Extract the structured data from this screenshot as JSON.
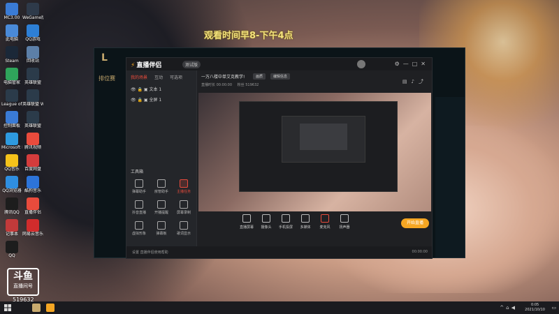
{
  "overlay": {
    "line1": "观看时间早8-下午4点"
  },
  "desktop_icons": [
    {
      "label": "MC3.00",
      "color": "#3a7bd5"
    },
    {
      "label": "WeGame版",
      "color": "#2e3a4a"
    },
    {
      "label": "此电脑",
      "color": "#4a8ad8"
    },
    {
      "label": "QQ游戏",
      "color": "#2d7fd6"
    },
    {
      "label": "Steam",
      "color": "#1b2838"
    },
    {
      "label": "回收站",
      "color": "#5c7fa8"
    },
    {
      "label": "电脑管家",
      "color": "#2fa45b"
    },
    {
      "label": "英雄联盟",
      "color": "#2b3b4a"
    },
    {
      "label": "League of Legends",
      "color": "#2b3b4a"
    },
    {
      "label": "英雄联盟 WeGame版",
      "color": "#2b3b4a"
    },
    {
      "label": "控制面板",
      "color": "#3a7bd5"
    },
    {
      "label": "英雄联盟",
      "color": "#2b3b4a"
    },
    {
      "label": "Microsoft Edge",
      "color": "#2e9adf"
    },
    {
      "label": "腾讯视频",
      "color": "#e94b3c"
    },
    {
      "label": "QQ音乐",
      "color": "#f5c21a"
    },
    {
      "label": "百度网盘",
      "color": "#d43c3c"
    },
    {
      "label": "QQ浏览器",
      "color": "#2f8ee0"
    },
    {
      "label": "酷狗音乐",
      "color": "#2d74d9"
    },
    {
      "label": "腾讯QQ",
      "color": "#1d1d1d"
    },
    {
      "label": "直播伴侣",
      "color": "#e94b3c"
    },
    {
      "label": "记事本",
      "color": "#c23a3a"
    },
    {
      "label": "网易云音乐",
      "color": "#d12c2c"
    },
    {
      "label": "QQ",
      "color": "#1d1d1d"
    }
  ],
  "lol": {
    "title": "排位赛"
  },
  "app": {
    "brand": "直播伴侣",
    "version": "测试版",
    "sidebar": {
      "tabs": [
        "我的场景",
        "互动",
        "可选项"
      ],
      "scenes": [
        "文本 1",
        "全屏 1"
      ],
      "tools_title": "工具箱",
      "tools": [
        {
          "label": "弹幕助手",
          "red": false
        },
        {
          "label": "房管助手",
          "red": false
        },
        {
          "label": "主播任务",
          "red": true
        },
        {
          "label": "抖音直播",
          "red": false
        },
        {
          "label": "开播提醒",
          "red": false
        },
        {
          "label": "屏幕录制",
          "red": false
        },
        {
          "label": "虚拟形象",
          "red": false
        },
        {
          "label": "弹幕板",
          "red": false
        },
        {
          "label": "歌词显示",
          "red": false
        }
      ]
    },
    "stream_title": "一万八楼中单艾克教学!",
    "chips": [
      "画质",
      "编辑信息"
    ],
    "stats": [
      "直播时长 00:00:00",
      "粉丝 519632"
    ],
    "bottom": [
      {
        "label": "直播屏幕",
        "red": false
      },
      {
        "label": "摄像头",
        "red": false
      },
      {
        "label": "手机投屏",
        "red": false
      },
      {
        "label": "多媒体",
        "red": false
      },
      {
        "label": "麦克风",
        "red": true
      },
      {
        "label": "扬声器",
        "red": false
      }
    ],
    "go_live": "开始直播",
    "status_left": "设置 直播伴侣使用帮助",
    "status_right": "00:00:00"
  },
  "watermark": {
    "brand": "斗鱼",
    "sub": "直播间号",
    "room": "519632"
  },
  "taskbar": {
    "time": "0:05",
    "date": "2021/10/10"
  }
}
